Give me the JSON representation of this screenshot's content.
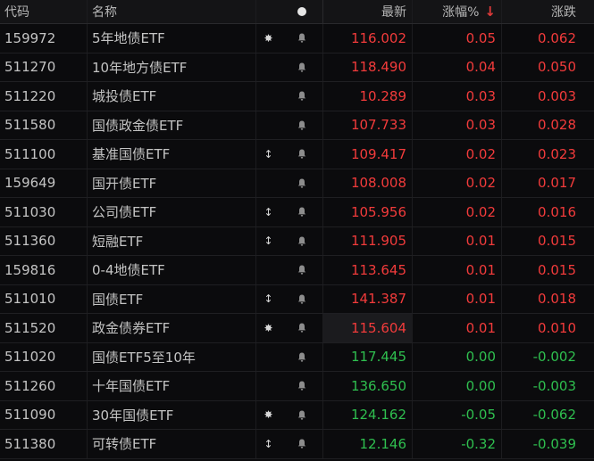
{
  "header": {
    "code": "代码",
    "name": "名称",
    "price": "最新",
    "pct": "涨幅%",
    "sort_arrow": "↓",
    "change": "涨跌"
  },
  "colors": {
    "up": "#f23b3b",
    "down": "#2fbf4f",
    "background": "#0b0b0d"
  },
  "rows": [
    {
      "code": "159972",
      "name": "5年地债ETF",
      "flag": "✸",
      "price": "116.002",
      "pct": "0.05",
      "change": "0.062",
      "dir": "up"
    },
    {
      "code": "511270",
      "name": "10年地方债ETF",
      "flag": "",
      "price": "118.490",
      "pct": "0.04",
      "change": "0.050",
      "dir": "up"
    },
    {
      "code": "511220",
      "name": "城投债ETF",
      "flag": "",
      "price": "10.289",
      "pct": "0.03",
      "change": "0.003",
      "dir": "up"
    },
    {
      "code": "511580",
      "name": "国债政金债ETF",
      "flag": "",
      "price": "107.733",
      "pct": "0.03",
      "change": "0.028",
      "dir": "up"
    },
    {
      "code": "511100",
      "name": "基准国债ETF",
      "flag": "↕",
      "price": "109.417",
      "pct": "0.02",
      "change": "0.023",
      "dir": "up"
    },
    {
      "code": "159649",
      "name": "国开债ETF",
      "flag": "",
      "price": "108.008",
      "pct": "0.02",
      "change": "0.017",
      "dir": "up"
    },
    {
      "code": "511030",
      "name": "公司债ETF",
      "flag": "↕",
      "price": "105.956",
      "pct": "0.02",
      "change": "0.016",
      "dir": "up"
    },
    {
      "code": "511360",
      "name": "短融ETF",
      "flag": "↕",
      "price": "111.905",
      "pct": "0.01",
      "change": "0.015",
      "dir": "up"
    },
    {
      "code": "159816",
      "name": "0-4地债ETF",
      "flag": "",
      "price": "113.645",
      "pct": "0.01",
      "change": "0.015",
      "dir": "up"
    },
    {
      "code": "511010",
      "name": "国债ETF",
      "flag": "↕",
      "price": "141.387",
      "pct": "0.01",
      "change": "0.018",
      "dir": "up"
    },
    {
      "code": "511520",
      "name": "政金债券ETF",
      "flag": "✸",
      "price": "115.604",
      "pct": "0.01",
      "change": "0.010",
      "dir": "up",
      "highlight": true
    },
    {
      "code": "511020",
      "name": "国债ETF5至10年",
      "flag": "",
      "price": "117.445",
      "pct": "0.00",
      "change": "-0.002",
      "dir": "flat"
    },
    {
      "code": "511260",
      "name": "十年国债ETF",
      "flag": "",
      "price": "136.650",
      "pct": "0.00",
      "change": "-0.003",
      "dir": "flat"
    },
    {
      "code": "511090",
      "name": "30年国债ETF",
      "flag": "✸",
      "price": "124.162",
      "pct": "-0.05",
      "change": "-0.062",
      "dir": "down"
    },
    {
      "code": "511380",
      "name": "可转债ETF",
      "flag": "↕",
      "price": "12.146",
      "pct": "-0.32",
      "change": "-0.039",
      "dir": "down"
    }
  ]
}
